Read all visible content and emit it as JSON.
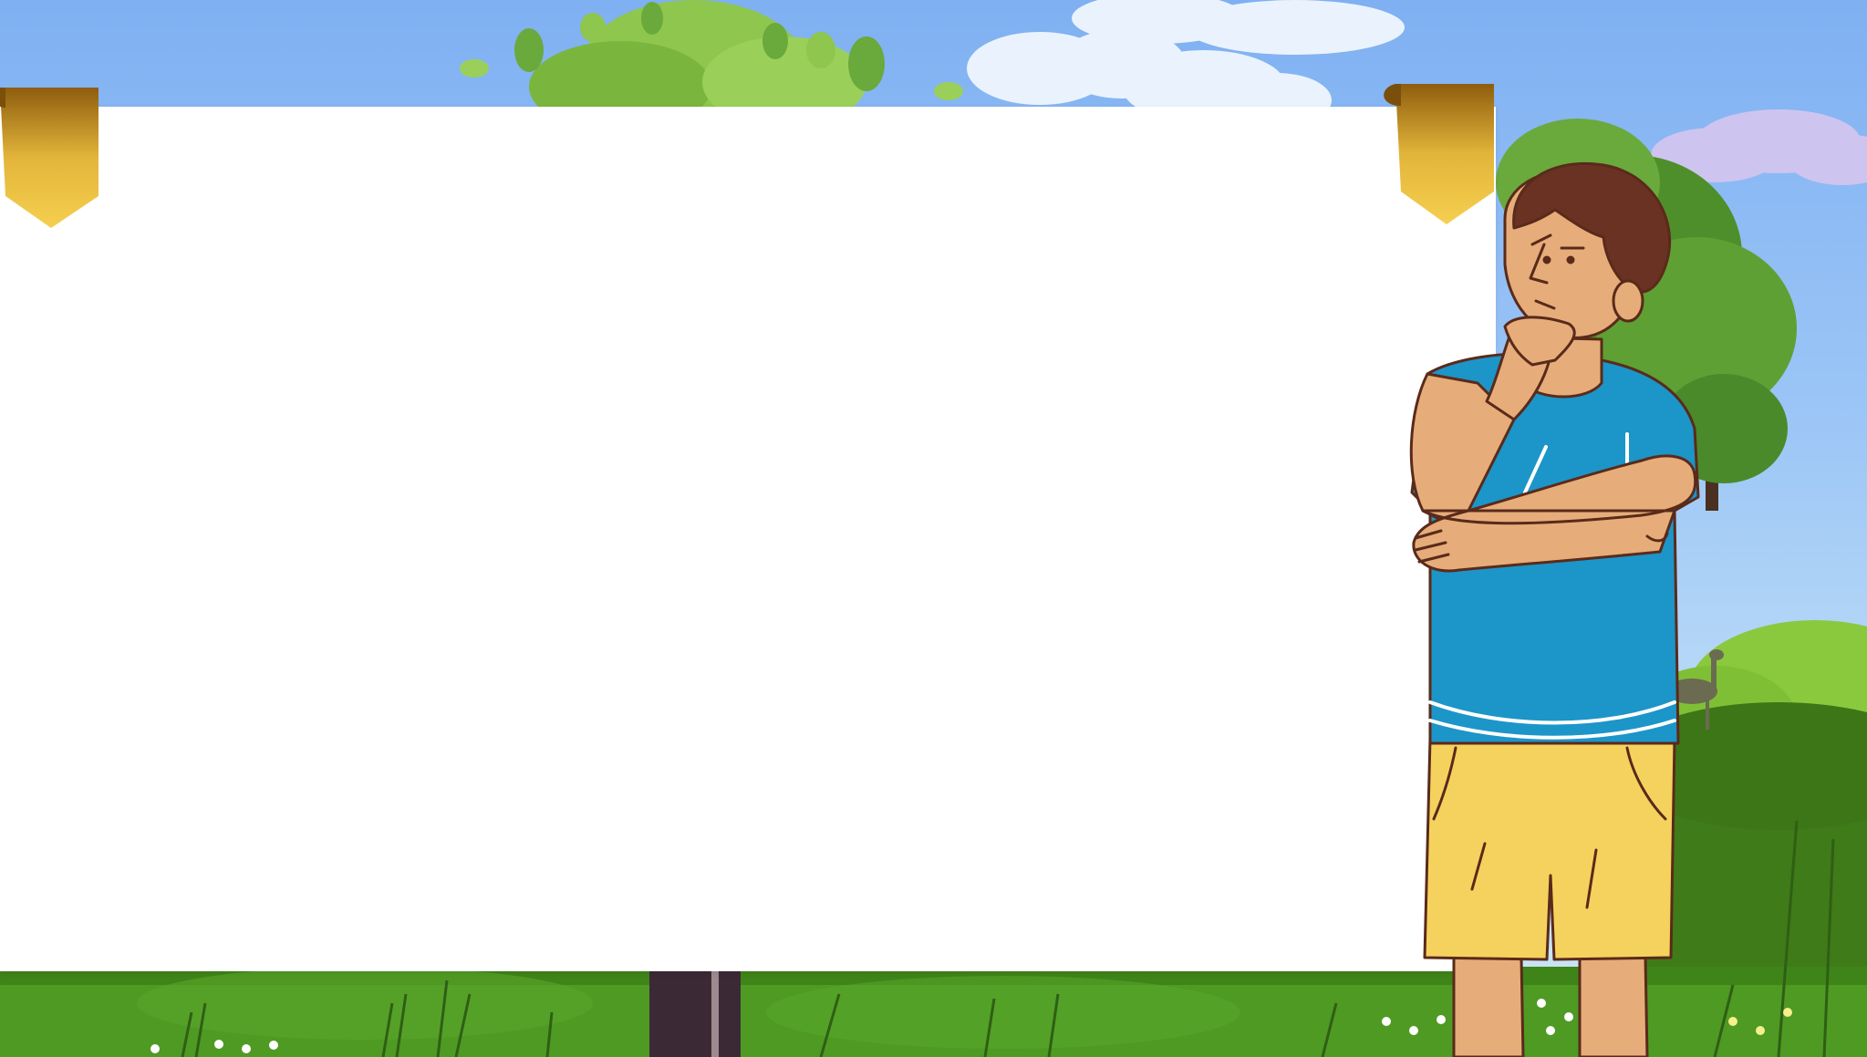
{
  "scene": {
    "description_tags": [
      "sky",
      "clouds",
      "tree",
      "bushes",
      "grass",
      "deer",
      "flowers"
    ],
    "colors": {
      "sky_top": "#7fb0f2",
      "sky_bottom": "#cfe6f2",
      "grass_dark": "#2f6a12",
      "grass_light": "#5fa52a",
      "leaf_light": "#8fc64f",
      "leaf_dark": "#4a8a2a",
      "ribbon_gold": "#e2b53a",
      "ribbon_dark": "#9a6a12",
      "shirt_blue": "#1c95c9",
      "shorts_yellow": "#f5d25e",
      "skin": "#e6ad7a",
      "hair": "#6a3223"
    }
  },
  "board": {
    "title": ""
  },
  "character": {
    "pose": "thinking"
  }
}
